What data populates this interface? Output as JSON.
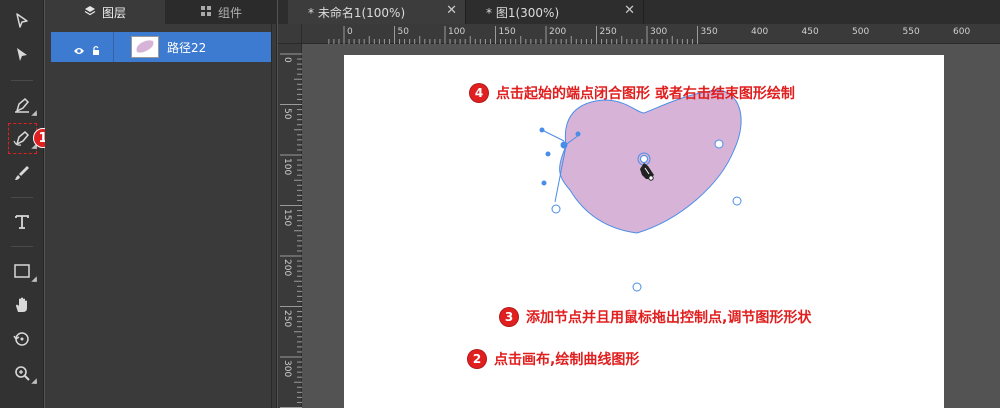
{
  "panel": {
    "tabs": [
      {
        "label": "图层",
        "icon": "layers-icon"
      },
      {
        "label": "组件",
        "icon": "grid-icon"
      }
    ],
    "layer": {
      "name": "路径22"
    }
  },
  "documents": [
    {
      "title": "* 未命名1(100%)",
      "close": "✕"
    },
    {
      "title": "* 图1(300%)",
      "close": "✕"
    }
  ],
  "ruler": {
    "horizontal": [
      "0",
      "50",
      "100",
      "150",
      "200",
      "250",
      "300",
      "350",
      "400",
      "450",
      "500",
      "550",
      "600"
    ],
    "vertical": [
      "0",
      "50",
      "100",
      "150",
      "200",
      "250",
      "300"
    ]
  },
  "annotations": {
    "step1": "1",
    "step2": {
      "num": "2",
      "text": "点击画布,绘制曲线图形"
    },
    "step3": {
      "num": "3",
      "text": "添加节点并且用鼠标拖出控制点,调节图形形状"
    },
    "step4": {
      "num": "4",
      "text": "点击起始的端点闭合图形 或者右击结束图形绘制"
    }
  },
  "colors": {
    "accent_blue": "#3d7bd1",
    "shape_fill": "#d7b4d7",
    "path_stroke": "#4a8de8",
    "annotation_red": "#e02020"
  }
}
